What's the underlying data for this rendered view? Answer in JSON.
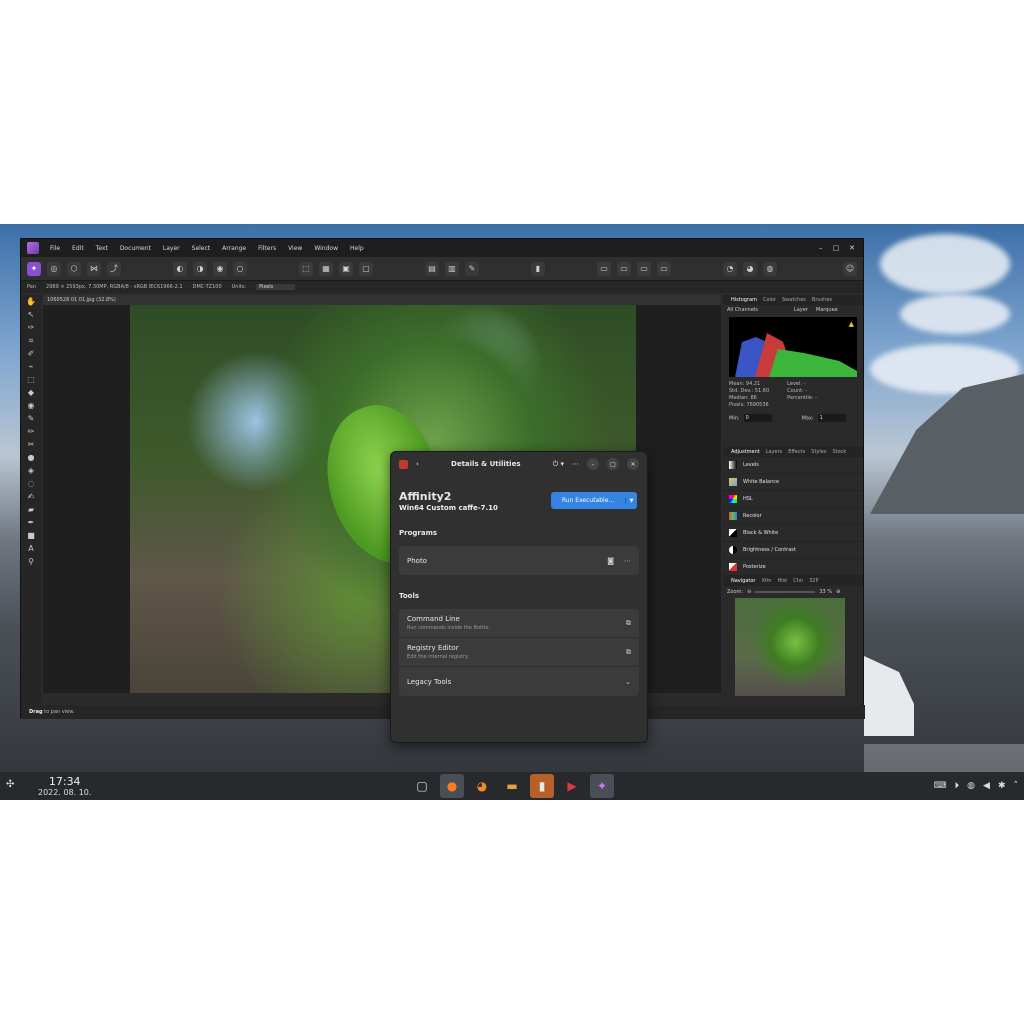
{
  "app": {
    "menu": [
      "File",
      "Edit",
      "Text",
      "Document",
      "Layer",
      "Select",
      "Arrange",
      "Filters",
      "View",
      "Window",
      "Help"
    ],
    "window_controls": [
      "–",
      "□",
      "✕"
    ],
    "context": {
      "info": "2989 × 2593px, 7.30MP, RGBA/8 - sRGB IEC61966-2.1",
      "camera": "DMC-TZ100",
      "units_label": "Units:",
      "units_value": "Pixels"
    },
    "doc_tab": "1060528 01 01.jpg (32.8%)",
    "status": {
      "bold": "Drag",
      "rest": "to pan view."
    },
    "panel_tabs_top": [
      "Histogram",
      "Color",
      "Swatches",
      "Brushes"
    ],
    "histogram": {
      "channels": "All Channels",
      "layer_label": "Layer",
      "marquee_label": "Marquee",
      "stats_left": [
        "Mean: 94.21",
        "Std. Dev.: 51.60",
        "Median: 86",
        "Pixels: 7690536"
      ],
      "stats_right": [
        "Level: -",
        "Count: -",
        "Percentile: -"
      ],
      "min_label": "Min:",
      "min_value": "0",
      "max_label": "Max:",
      "max_value": "1"
    },
    "panel_tabs_mid": [
      "Adjustment",
      "Layers",
      "Effects",
      "Styles",
      "Stock"
    ],
    "adjustments": [
      "Levels",
      "White Balance",
      "HSL",
      "Recolor",
      "Black & White",
      "Brightness / Contrast",
      "Posterize"
    ],
    "panel_tabs_bottom": [
      "Navigator",
      "Xfm",
      "Hist",
      "Chn",
      "32P"
    ],
    "navigator": {
      "zoom_label": "Zoom:",
      "zoom_value": "33 %"
    }
  },
  "dialog": {
    "title": "Details & Utilities",
    "app_name": "Affinity2",
    "runner": "Win64 Custom caffe-7.10",
    "run_button": "Run Executable...",
    "programs_heading": "Programs",
    "programs": [
      {
        "name": "Photo"
      }
    ],
    "tools_heading": "Tools",
    "tools": [
      {
        "title": "Command Line",
        "desc": "Run commands inside the Bottle."
      },
      {
        "title": "Registry Editor",
        "desc": "Edit the internal registry."
      },
      {
        "title": "Legacy Tools",
        "desc": ""
      }
    ]
  },
  "taskbar": {
    "time": "17:34",
    "date": "2022. 08. 10."
  },
  "colors": {
    "accent": "#3584e4",
    "persona": "#8a4fd0",
    "taskbar": "#27292d"
  }
}
